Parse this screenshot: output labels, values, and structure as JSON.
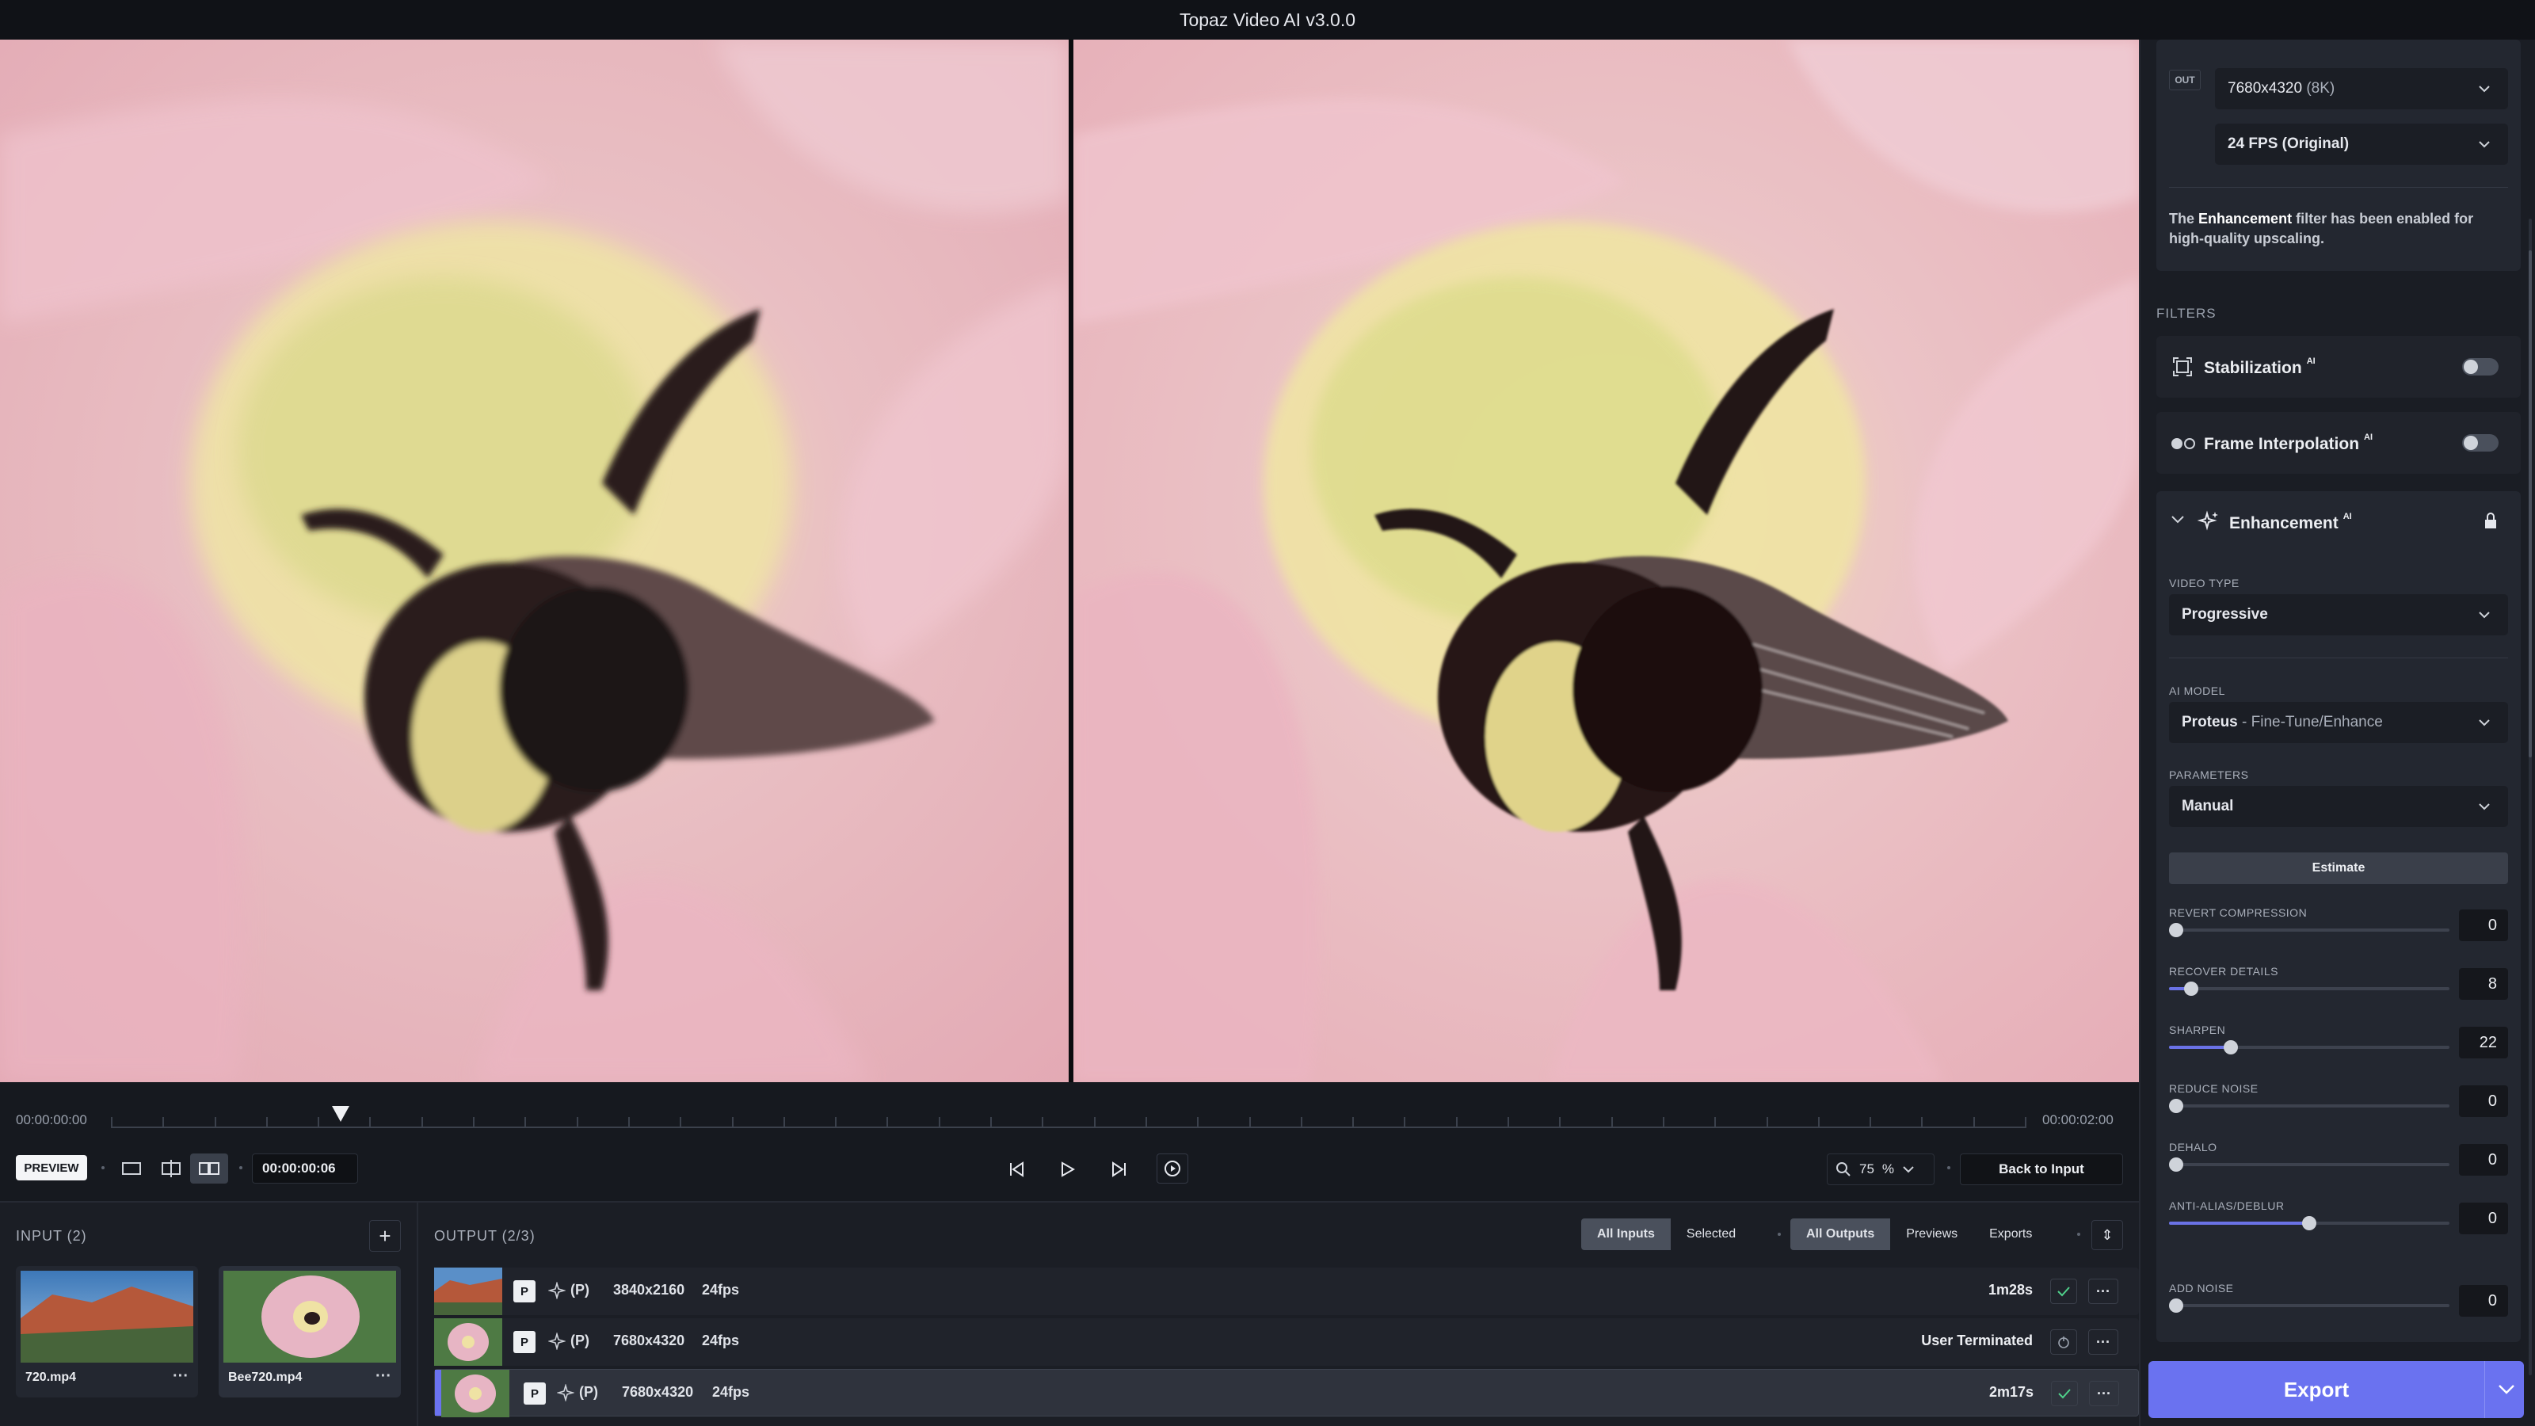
{
  "app": {
    "title": "Topaz Video AI  v3.0.0"
  },
  "timeline": {
    "start_time": "00:00:00:00",
    "end_time": "00:00:02:00",
    "current_timecode": "00:00:00:06",
    "playhead_fraction": 0.12,
    "preview_label": "PREVIEW",
    "zoom_value": "75",
    "zoom_unit": "%",
    "back_label": "Back to Input"
  },
  "input": {
    "header": "INPUT (2)",
    "items": [
      {
        "name": "720.mp4",
        "more": "···"
      },
      {
        "name": "Bee720.mp4",
        "more": "···"
      }
    ]
  },
  "output": {
    "header": "OUTPUT (2/3)",
    "input_filters": [
      "All Inputs",
      "Selected"
    ],
    "output_filters": [
      "All Outputs",
      "Previews",
      "Exports"
    ],
    "rows": [
      {
        "badge": "P",
        "mode": "(P)",
        "resolution": "3840x2160",
        "fps": "24fps",
        "status": "1m28s",
        "more": "···"
      },
      {
        "badge": "P",
        "mode": "(P)",
        "resolution": "7680x4320",
        "fps": "24fps",
        "status": "User Terminated",
        "more": "···"
      },
      {
        "badge": "P",
        "mode": "(P)",
        "resolution": "7680x4320",
        "fps": "24fps",
        "status": "2m17s",
        "more": "···"
      }
    ]
  },
  "sidebar": {
    "out_tag": "OUT",
    "resolution": "7680x4320",
    "resolution_note": "(8K)",
    "fps": "24 FPS (Original)",
    "note_prefix": "The",
    "note_highlight": "Enhancement",
    "note_rest": "filter has been enabled for high-quality upscaling.",
    "filters_label": "FILTERS",
    "filters": [
      {
        "name": "Stabilization",
        "sup": "AI"
      },
      {
        "name": "Frame Interpolation",
        "sup": "AI"
      }
    ],
    "enhancement": {
      "name": "Enhancement",
      "sup": "AI",
      "video_type_label": "VIDEO TYPE",
      "video_type": "Progressive",
      "ai_model_label": "AI MODEL",
      "ai_model": "Proteus",
      "ai_model_sub": "- Fine-Tune/Enhance",
      "parameters_label": "PARAMETERS",
      "parameters": "Manual",
      "estimate_label": "Estimate",
      "sliders": [
        {
          "label": "REVERT COMPRESSION",
          "value": "0",
          "fraction": 0.0
        },
        {
          "label": "RECOVER DETAILS",
          "value": "8",
          "fraction": 0.08
        },
        {
          "label": "SHARPEN",
          "value": "22",
          "fraction": 0.22
        },
        {
          "label": "REDUCE NOISE",
          "value": "0",
          "fraction": 0.0
        },
        {
          "label": "DEHALO",
          "value": "0",
          "fraction": 0.0
        },
        {
          "label": "ANTI-ALIAS/DEBLUR",
          "value": "0",
          "fraction": 0.5
        },
        {
          "label": "ADD NOISE",
          "value": "0",
          "fraction": 0.0
        }
      ]
    },
    "export_label": "Export"
  },
  "colors": {
    "accent": "#6a72f0",
    "background": "#16191f",
    "panel": "#1b1e25"
  }
}
